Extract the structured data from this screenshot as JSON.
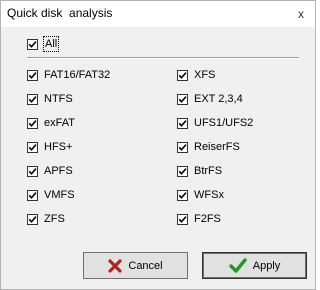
{
  "window": {
    "title": "Quick disk  analysis",
    "close_glyph": "x"
  },
  "all_option": {
    "label": "All",
    "checked": true
  },
  "left_options": [
    {
      "label": "FAT16/FAT32",
      "checked": true
    },
    {
      "label": "NTFS",
      "checked": true
    },
    {
      "label": "exFAT",
      "checked": true
    },
    {
      "label": "HFS+",
      "checked": true
    },
    {
      "label": "APFS",
      "checked": true
    },
    {
      "label": "VMFS",
      "checked": true
    },
    {
      "label": "ZFS",
      "checked": true
    }
  ],
  "right_options": [
    {
      "label": "XFS",
      "checked": true
    },
    {
      "label": "EXT 2,3,4",
      "checked": true
    },
    {
      "label": "UFS1/UFS2",
      "checked": true
    },
    {
      "label": "ReiserFS",
      "checked": true
    },
    {
      "label": "BtrFS",
      "checked": true
    },
    {
      "label": "WFSx",
      "checked": true
    },
    {
      "label": "F2FS",
      "checked": true
    }
  ],
  "buttons": {
    "cancel": {
      "label": "Cancel",
      "icon": "x-mark-icon",
      "icon_color": "#b22222"
    },
    "apply": {
      "label": "Apply",
      "icon": "checkmark-icon",
      "icon_color": "#1e9a1e"
    }
  }
}
